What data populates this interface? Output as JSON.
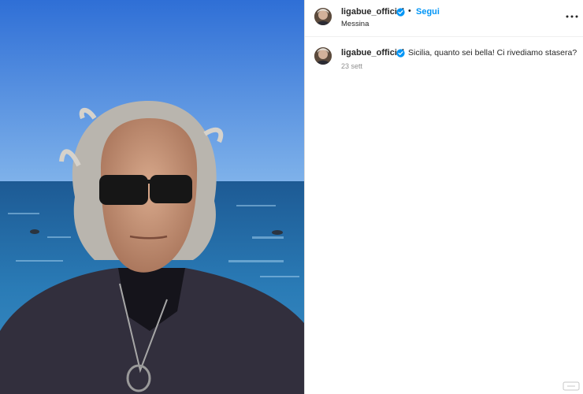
{
  "post": {
    "author": "ligabue_official",
    "follow_label": "Segui",
    "separator": "•",
    "location": "Messina",
    "caption": "Sicilia, quanto sei bella! Ci rivediamo stasera?",
    "date": "23 sett"
  },
  "colors": {
    "accent": "#0095f6",
    "verified": "#0095f6",
    "text": "#262626",
    "muted": "#8e8e8e"
  },
  "icons": {
    "verified": "verified-badge-icon",
    "more": "more-options-icon"
  }
}
